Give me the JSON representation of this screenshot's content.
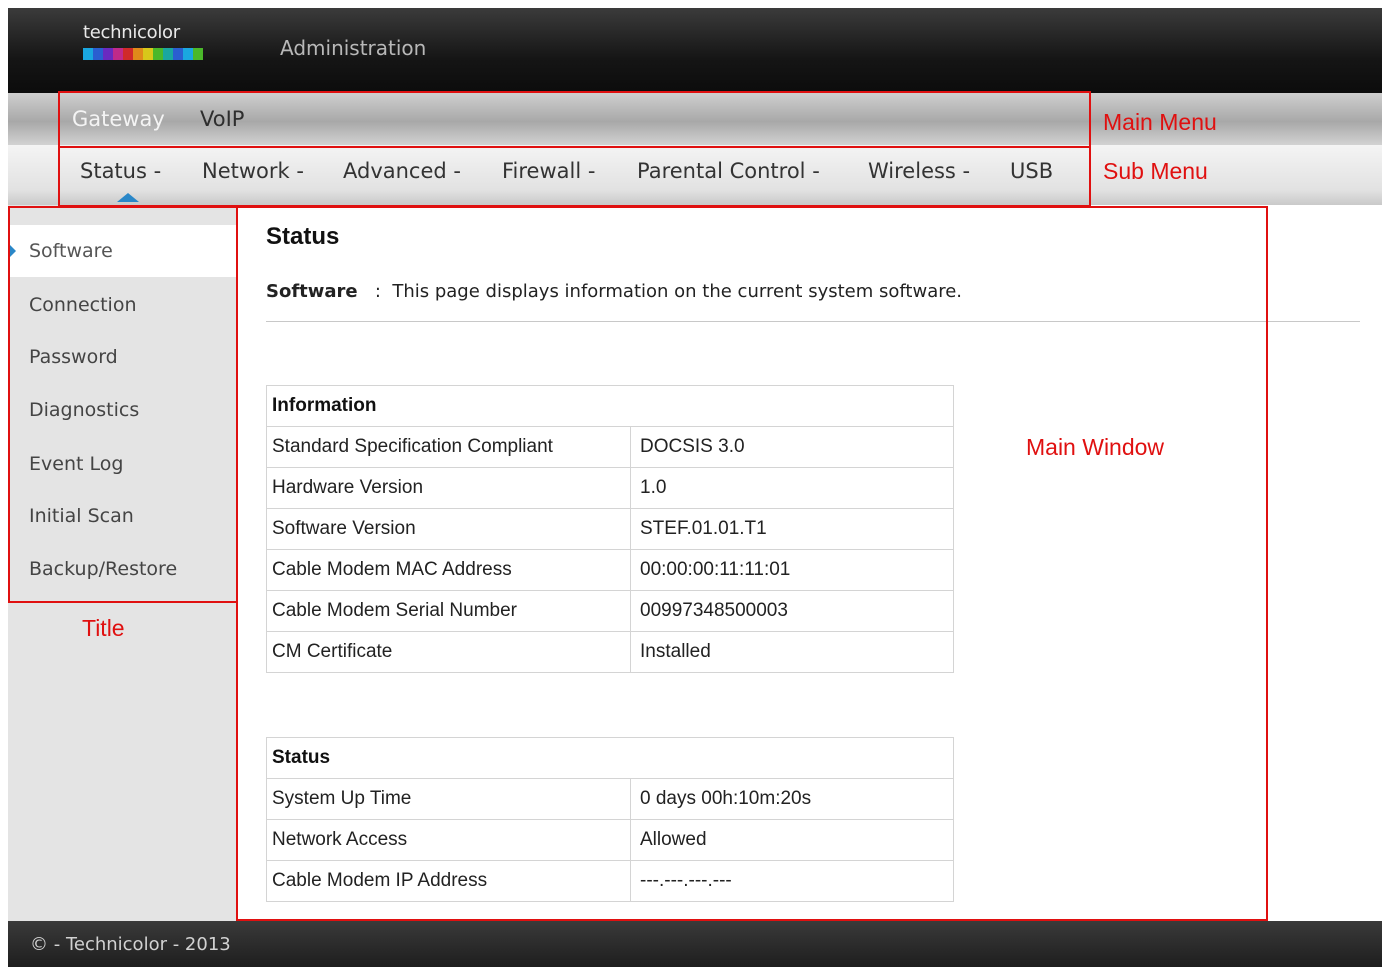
{
  "header": {
    "logo_text": "technicolor",
    "title": "Administration"
  },
  "main_menu": {
    "items": [
      "Gateway",
      "VoIP"
    ],
    "active": "Gateway"
  },
  "sub_menu": {
    "items": [
      "Status -",
      "Network -",
      "Advanced -",
      "Firewall -",
      "Parental Control -",
      "Wireless -",
      "USB"
    ],
    "active": "Status -"
  },
  "sidebar": {
    "items": [
      "Software",
      "Connection",
      "Password",
      "Diagnostics",
      "Event Log",
      "Initial Scan",
      "Backup/Restore"
    ],
    "active": "Software"
  },
  "content": {
    "heading": "Status",
    "desc_label": "Software",
    "desc_sep": ":",
    "desc_text": "This page displays information on the current system software.",
    "information": {
      "header": "Information",
      "rows": [
        {
          "label": "Standard Specification Compliant",
          "value": "DOCSIS 3.0"
        },
        {
          "label": "Hardware Version",
          "value": "1.0"
        },
        {
          "label": "Software Version",
          "value": "STEF.01.01.T1"
        },
        {
          "label": "Cable Modem MAC Address",
          "value": "00:00:00:11:11:01"
        },
        {
          "label": "Cable Modem Serial Number",
          "value": "00997348500003"
        },
        {
          "label": "CM Certificate",
          "value": "Installed"
        }
      ]
    },
    "status": {
      "header": "Status",
      "rows": [
        {
          "label": "System Up Time",
          "value": "0 days 00h:10m:20s"
        },
        {
          "label": "Network Access",
          "value": "Allowed"
        },
        {
          "label": "Cable Modem IP Address",
          "value": "---.---.---.---"
        }
      ]
    }
  },
  "annotations": {
    "main_menu": "Main Menu",
    "sub_menu": "Sub Menu",
    "main_window": "Main Window",
    "title": "Title"
  },
  "footer": {
    "text": "© - Technicolor - 2013"
  },
  "colors": {
    "accent": "#2a87c8",
    "annotation": "#e01010",
    "header_bg": "#151515"
  }
}
